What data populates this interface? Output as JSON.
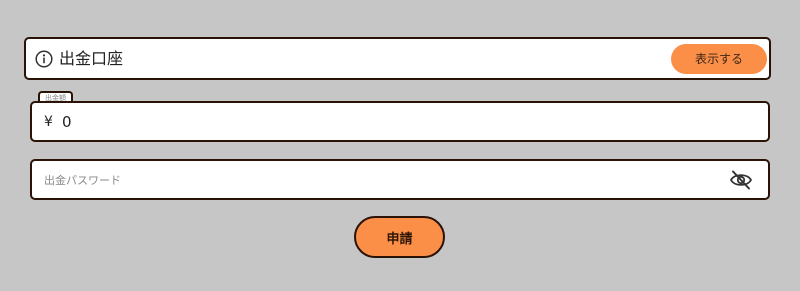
{
  "account": {
    "icon": "info-icon",
    "title": "出金口座",
    "show_button_label": "表示する"
  },
  "amount": {
    "label": "出金額",
    "currency_symbol": "¥",
    "value": "0"
  },
  "password": {
    "placeholder": "出金パスワード",
    "toggle_icon": "eye-off-icon"
  },
  "submit": {
    "label": "申請"
  },
  "colors": {
    "background": "#c6c6c6",
    "accent": "#fb8f48",
    "border": "#2a1206"
  }
}
